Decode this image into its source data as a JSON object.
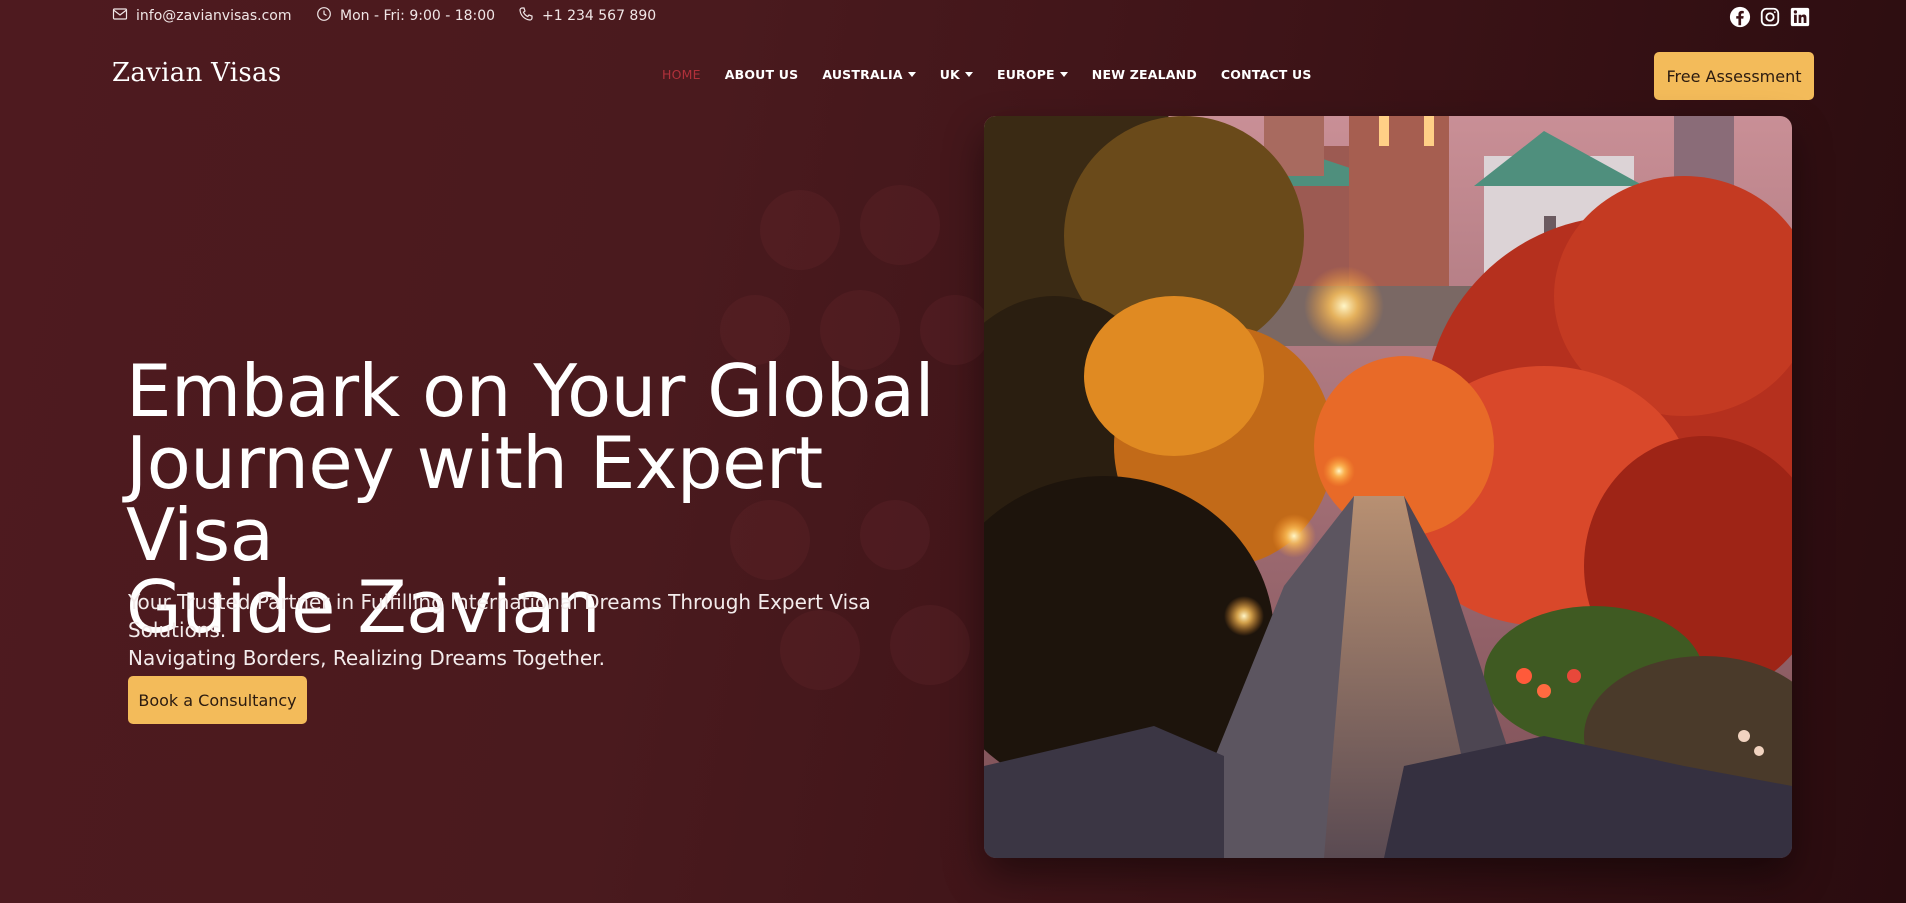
{
  "topbar": {
    "email": "info@zavianvisas.com",
    "hours": "Mon - Fri: 9:00 - 18:00",
    "phone": "+1 234 567 890",
    "icons": [
      "mail-icon",
      "clock-icon",
      "phone-icon"
    ],
    "social": [
      "facebook-icon",
      "instagram-icon",
      "linkedin-icon"
    ]
  },
  "header": {
    "logo": "Zavian Visas",
    "nav": [
      {
        "label": "HOME",
        "active": true,
        "dropdown": false
      },
      {
        "label": "ABOUT US",
        "active": false,
        "dropdown": false
      },
      {
        "label": "AUSTRALIA",
        "active": false,
        "dropdown": true
      },
      {
        "label": "UK",
        "active": false,
        "dropdown": true
      },
      {
        "label": "EUROPE",
        "active": false,
        "dropdown": true
      },
      {
        "label": "NEW ZEALAND",
        "active": false,
        "dropdown": false
      },
      {
        "label": "CONTACT US",
        "active": false,
        "dropdown": false
      }
    ],
    "cta": "Free Assessment"
  },
  "hero": {
    "title_lines": [
      "Embark on Your Global",
      "Journey with Expert Visa",
      "Guide Zavian"
    ],
    "subtitle_lines": [
      "Your Trusted Partner in Fulfilling International Dreams Through Expert Visa Solutions.",
      "Navigating Borders, Realizing Dreams Together."
    ],
    "cta": "Book a Consultancy"
  },
  "colors": {
    "background": "#4a1a1e",
    "accent": "#f3bb5a",
    "nav_active": "#b0303a"
  }
}
